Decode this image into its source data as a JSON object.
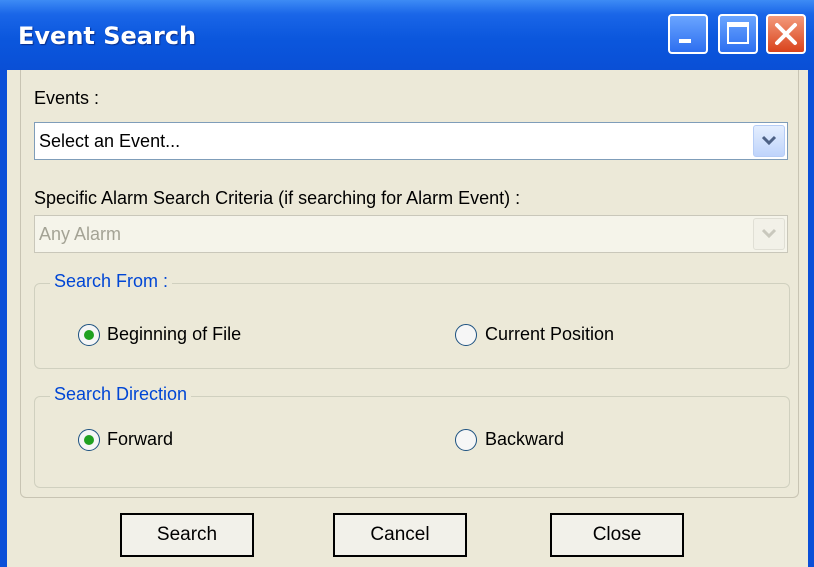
{
  "window": {
    "title": "Event Search"
  },
  "events": {
    "label": "Events :",
    "selected": "Select an Event..."
  },
  "alarm": {
    "label": "Specific Alarm Search Criteria (if searching for Alarm Event) :",
    "selected": "Any Alarm"
  },
  "search_from": {
    "legend": "Search From :",
    "options": [
      {
        "label": "Beginning of File",
        "checked": true
      },
      {
        "label": "Current Position",
        "checked": false
      }
    ]
  },
  "search_direction": {
    "legend": "Search Direction",
    "options": [
      {
        "label": "Forward",
        "checked": true
      },
      {
        "label": "Backward",
        "checked": false
      }
    ]
  },
  "buttons": {
    "search": "Search",
    "cancel": "Cancel",
    "close": "Close"
  },
  "colors": {
    "titlebar": "#0a4fd8",
    "client": "#ece9d8",
    "legend_text": "#0046d5",
    "radio_dot": "#21a121"
  }
}
